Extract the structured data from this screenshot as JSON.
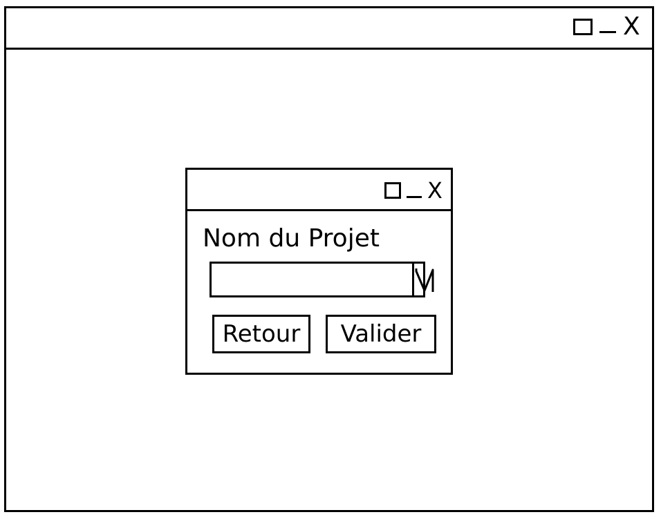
{
  "main_window": {
    "controls": {
      "close_glyph": "X"
    }
  },
  "dialog": {
    "controls": {
      "close_glyph": "X"
    },
    "field": {
      "label": "Nom du Projet",
      "value": "",
      "dropdown_icon": "chevron-down-icon"
    },
    "buttons": {
      "back_label": "Retour",
      "validate_label": "Valider"
    }
  }
}
